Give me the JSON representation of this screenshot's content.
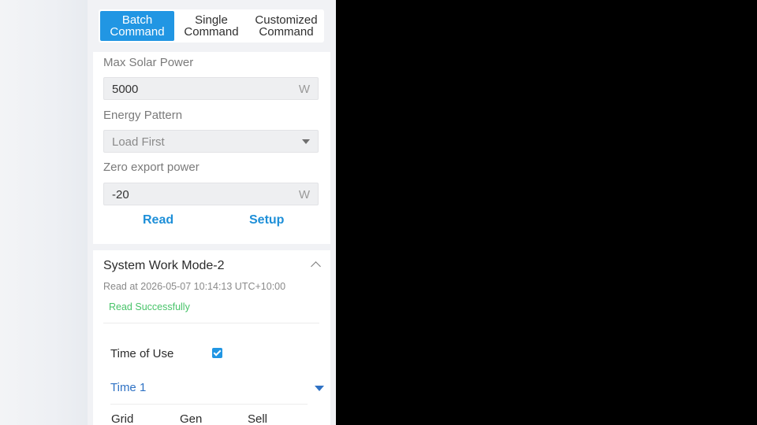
{
  "tabs": [
    {
      "label": "Batch\nCommand",
      "active": true
    },
    {
      "label": "Single\nCommand",
      "active": false
    },
    {
      "label": "Customized\nCommand",
      "active": false
    }
  ],
  "settings": {
    "max_solar_power": {
      "label": "Max Solar Power",
      "value": "5000",
      "unit": "W"
    },
    "energy_pattern": {
      "label": "Energy Pattern",
      "value": "Load First"
    },
    "zero_export_power": {
      "label": "Zero export power",
      "value": "-20",
      "unit": "W"
    },
    "read_label": "Read",
    "setup_label": "Setup"
  },
  "work_mode": {
    "title": "System Work Mode-2",
    "read_at": "Read at 2026-05-07 10:14:13 UTC+10:00",
    "status": "Read Successfully",
    "time_of_use_label": "Time of Use",
    "time_of_use_checked": true,
    "time_slot": "Time 1",
    "columns": [
      "Grid",
      "Gen",
      "Sell"
    ]
  },
  "colors": {
    "accent": "#2196e3",
    "link": "#1e8fd8",
    "success": "#49c46a",
    "select_blue": "#2f72c4"
  }
}
